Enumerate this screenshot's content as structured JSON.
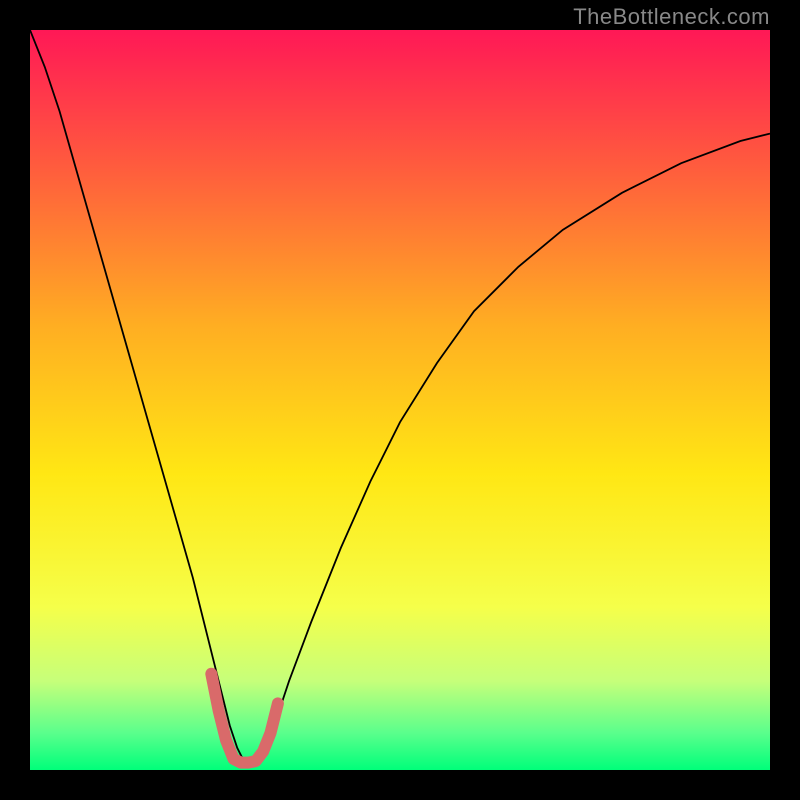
{
  "watermark": "TheBottleneck.com",
  "chart_data": {
    "type": "line",
    "title": "",
    "xlabel": "",
    "ylabel": "",
    "xlim": [
      0,
      100
    ],
    "ylim": [
      0,
      100
    ],
    "background_gradient": {
      "stops": [
        {
          "offset": 0,
          "color": "#ff1856"
        },
        {
          "offset": 18,
          "color": "#ff5a3e"
        },
        {
          "offset": 40,
          "color": "#ffae22"
        },
        {
          "offset": 60,
          "color": "#ffe714"
        },
        {
          "offset": 78,
          "color": "#f5ff4a"
        },
        {
          "offset": 88,
          "color": "#c6ff7a"
        },
        {
          "offset": 95,
          "color": "#5aff8c"
        },
        {
          "offset": 100,
          "color": "#00ff7a"
        }
      ]
    },
    "series": [
      {
        "name": "bottleneck-curve",
        "color": "#000000",
        "width": 1.8,
        "x": [
          0,
          2,
          4,
          6,
          8,
          10,
          12,
          14,
          16,
          18,
          20,
          22,
          24,
          26,
          27,
          28,
          29,
          30,
          31,
          33,
          35,
          38,
          42,
          46,
          50,
          55,
          60,
          66,
          72,
          80,
          88,
          96,
          100
        ],
        "y": [
          100,
          95,
          89,
          82,
          75,
          68,
          61,
          54,
          47,
          40,
          33,
          26,
          18,
          10,
          6,
          3,
          1,
          1,
          2,
          6,
          12,
          20,
          30,
          39,
          47,
          55,
          62,
          68,
          73,
          78,
          82,
          85,
          86
        ]
      },
      {
        "name": "optimal-zone-marker",
        "color": "#d96a6a",
        "width": 12,
        "linecap": "round",
        "x": [
          24.5,
          25.5,
          26.5,
          27.5,
          28.5,
          29.5,
          30.5,
          31.5,
          32.5,
          33.5
        ],
        "y": [
          13,
          8,
          4,
          1.5,
          1,
          1,
          1.2,
          2.5,
          5,
          9
        ]
      }
    ]
  }
}
